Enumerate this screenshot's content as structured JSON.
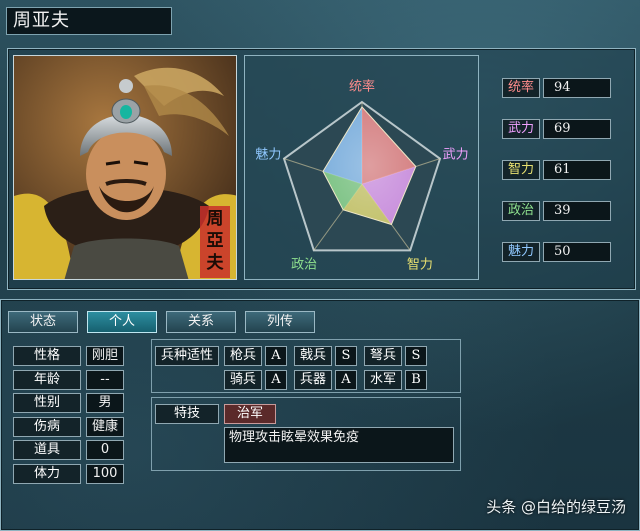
{
  "character": {
    "name": "周亚夫",
    "portrait_seal": "周亞夫"
  },
  "radar": {
    "axes": [
      "统率",
      "武力",
      "智力",
      "政治",
      "魅力"
    ],
    "values": [
      94,
      69,
      61,
      39,
      50
    ],
    "max": 100,
    "axis_colors": [
      "#ff8c8c",
      "#f0a0ff",
      "#e8e070",
      "#8ee08e",
      "#90c8ff"
    ]
  },
  "stats": [
    {
      "label": "统率",
      "value": "94",
      "color": "#ff8c8c"
    },
    {
      "label": "武力",
      "value": "69",
      "color": "#f0a0ff"
    },
    {
      "label": "智力",
      "value": "61",
      "color": "#e8e070"
    },
    {
      "label": "政治",
      "value": "39",
      "color": "#8ee08e"
    },
    {
      "label": "魅力",
      "value": "50",
      "color": "#90c8ff"
    }
  ],
  "tabs": [
    {
      "label": "状态",
      "active": false
    },
    {
      "label": "个人",
      "active": true
    },
    {
      "label": "关系",
      "active": false
    },
    {
      "label": "列传",
      "active": false
    }
  ],
  "personal": [
    {
      "label": "性格",
      "value": "刚胆"
    },
    {
      "label": "年龄",
      "value": "--"
    },
    {
      "label": "性别",
      "value": "男"
    },
    {
      "label": "伤病",
      "value": "健康"
    },
    {
      "label": "道具",
      "value": "0"
    },
    {
      "label": "体力",
      "value": "100"
    }
  ],
  "proficiency": {
    "title": "兵种适性",
    "items": [
      {
        "label": "枪兵",
        "grade": "A"
      },
      {
        "label": "戟兵",
        "grade": "S"
      },
      {
        "label": "弩兵",
        "grade": "S"
      },
      {
        "label": "骑兵",
        "grade": "A"
      },
      {
        "label": "兵器",
        "grade": "A"
      },
      {
        "label": "水军",
        "grade": "B"
      }
    ]
  },
  "skill": {
    "title": "特技",
    "name": "治军",
    "description": "物理攻击眩晕效果免疫"
  },
  "watermark": "头条 @白给的绿豆汤"
}
